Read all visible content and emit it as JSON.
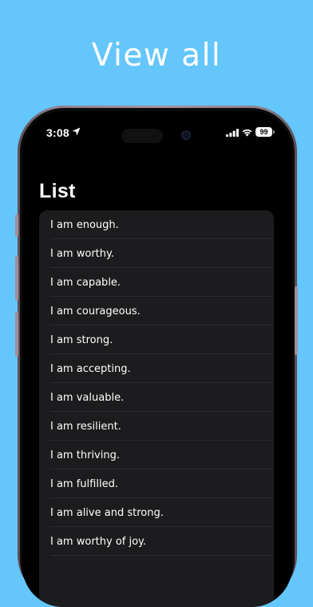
{
  "headline": "View all",
  "status_bar": {
    "time": "3:08",
    "battery": "99"
  },
  "page": {
    "title": "List"
  },
  "list": {
    "items": [
      {
        "label": "I am enough."
      },
      {
        "label": "I am worthy."
      },
      {
        "label": "I am capable."
      },
      {
        "label": "I am courageous."
      },
      {
        "label": "I am strong."
      },
      {
        "label": "I am accepting."
      },
      {
        "label": "I am valuable."
      },
      {
        "label": "I am resilient."
      },
      {
        "label": "I am thriving."
      },
      {
        "label": "I am fulfilled."
      },
      {
        "label": "I am alive and strong."
      },
      {
        "label": "I am worthy of joy."
      }
    ]
  },
  "colors": {
    "background": "#64c6fb",
    "screen": "#000000",
    "list_background": "#1c1c1e",
    "separator": "#2c2c2e",
    "text": "#ffffff"
  }
}
